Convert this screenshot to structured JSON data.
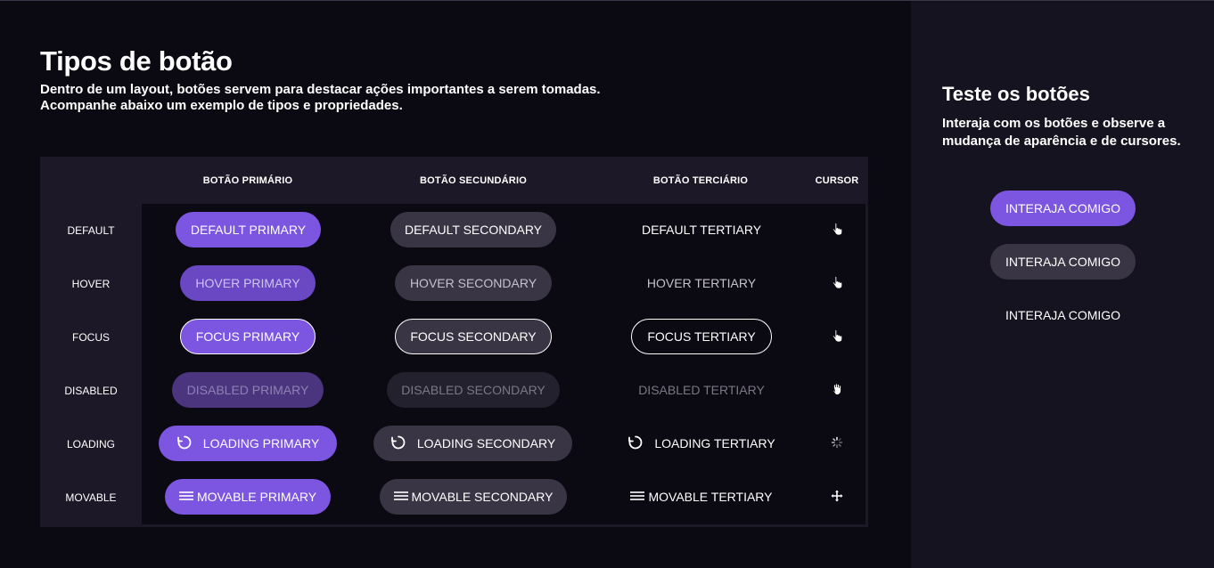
{
  "header": {
    "title": "Tipos de botão",
    "subtitle_line1": "Dentro de um layout, botões servem para destacar ações importantes a serem tomadas.",
    "subtitle_line2": "Acompanhe abaixo um exemplo de tipos e propriedades."
  },
  "table": {
    "columns": {
      "primary": "BOTÃO PRIMÁRIO",
      "secondary": "BOTÃO SECUNDÁRIO",
      "tertiary": "BOTÃO TERCIÁRIO",
      "cursor": "CURSOR"
    },
    "rows": {
      "default": {
        "label": "DEFAULT",
        "primary": "DEFAULT PRIMARY",
        "secondary": "DEFAULT SECONDARY",
        "tertiary": "DEFAULT TERTIARY",
        "cursor_icon": "pointer-hand-icon"
      },
      "hover": {
        "label": "HOVER",
        "primary": "HOVER PRIMARY",
        "secondary": "HOVER SECONDARY",
        "tertiary": "HOVER TERTIARY",
        "cursor_icon": "pointer-hand-icon"
      },
      "focus": {
        "label": "FOCUS",
        "primary": "FOCUS PRIMARY",
        "secondary": "FOCUS SECONDARY",
        "tertiary": "FOCUS TERTIARY",
        "cursor_icon": "pointer-hand-icon"
      },
      "disabled": {
        "label": "DISABLED",
        "primary": "DISABLED PRIMARY",
        "secondary": "DISABLED SECONDARY",
        "tertiary": "DISABLED TERTIARY",
        "cursor_icon": "not-allowed-hand-icon"
      },
      "loading": {
        "label": "LOADING",
        "primary": "LOADING PRIMARY",
        "secondary": "LOADING SECONDARY",
        "tertiary": "LOADING TERTIARY",
        "cursor_icon": "loading-spinner-icon"
      },
      "movable": {
        "label": "MOVABLE",
        "primary": "MOVABLE PRIMARY",
        "secondary": "MOVABLE SECONDARY",
        "tertiary": "MOVABLE TERTIARY",
        "cursor_icon": "move-arrows-icon"
      }
    }
  },
  "aside": {
    "title": "Teste os botões",
    "text": "Interaja com os botões e observe a mudança de aparência e de cursores.",
    "buttons": {
      "primary": "INTERAJA COMIGO",
      "secondary": "INTERAJA COMIGO",
      "tertiary": "INTERAJA COMIGO"
    }
  },
  "colors": {
    "background": "#0b0912",
    "aside_background": "#161320",
    "table_header": "#1c1828",
    "primary": "#7c55e0",
    "secondary": "#393545"
  }
}
